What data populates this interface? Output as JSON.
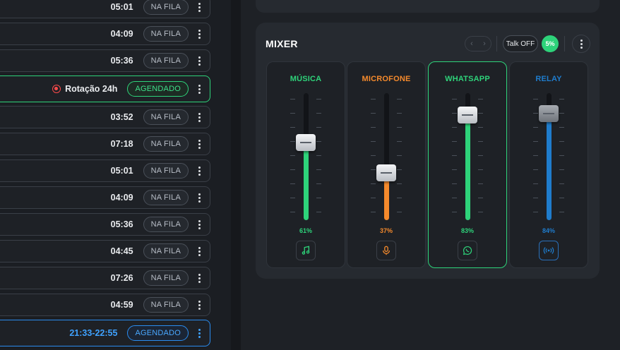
{
  "queue": {
    "rows": [
      {
        "time": "05:01",
        "status": "NA FILA"
      },
      {
        "time": "04:09",
        "status": "NA FILA"
      },
      {
        "time": "05:36",
        "status": "NA FILA"
      },
      {
        "label": "Rotação 24h",
        "status": "AGENDADO"
      },
      {
        "time": "03:52",
        "status": "NA FILA"
      },
      {
        "time": "07:18",
        "status": "NA FILA"
      },
      {
        "time": "05:01",
        "status": "NA FILA"
      },
      {
        "time": "04:09",
        "status": "NA FILA"
      },
      {
        "time": "05:36",
        "status": "NA FILA"
      },
      {
        "time": "04:45",
        "status": "NA FILA"
      },
      {
        "time": "07:26",
        "status": "NA FILA"
      },
      {
        "time": "04:59",
        "status": "NA FILA"
      },
      {
        "time": "21:33-22:55",
        "status": "AGENDADO"
      }
    ]
  },
  "mixer": {
    "title": "MIXER",
    "nav_prev": "‹",
    "nav_next": "›",
    "talk_label": "Talk OFF",
    "talk_percent": "5%",
    "channels": [
      {
        "name": "MÚSICA",
        "value_label": "61%",
        "level": 0.61,
        "color": "#2ed37a",
        "icon": "music-note-icon"
      },
      {
        "name": "MICROFONE",
        "value_label": "37%",
        "level": 0.37,
        "color": "#f58a2c",
        "icon": "microphone-icon"
      },
      {
        "name": "WHATSAPP",
        "value_label": "83%",
        "level": 0.83,
        "color": "#2ed37a",
        "icon": "whatsapp-icon"
      },
      {
        "name": "RELAY",
        "value_label": "84%",
        "level": 0.84,
        "color": "#1f7ccc",
        "icon": "broadcast-icon"
      }
    ]
  }
}
